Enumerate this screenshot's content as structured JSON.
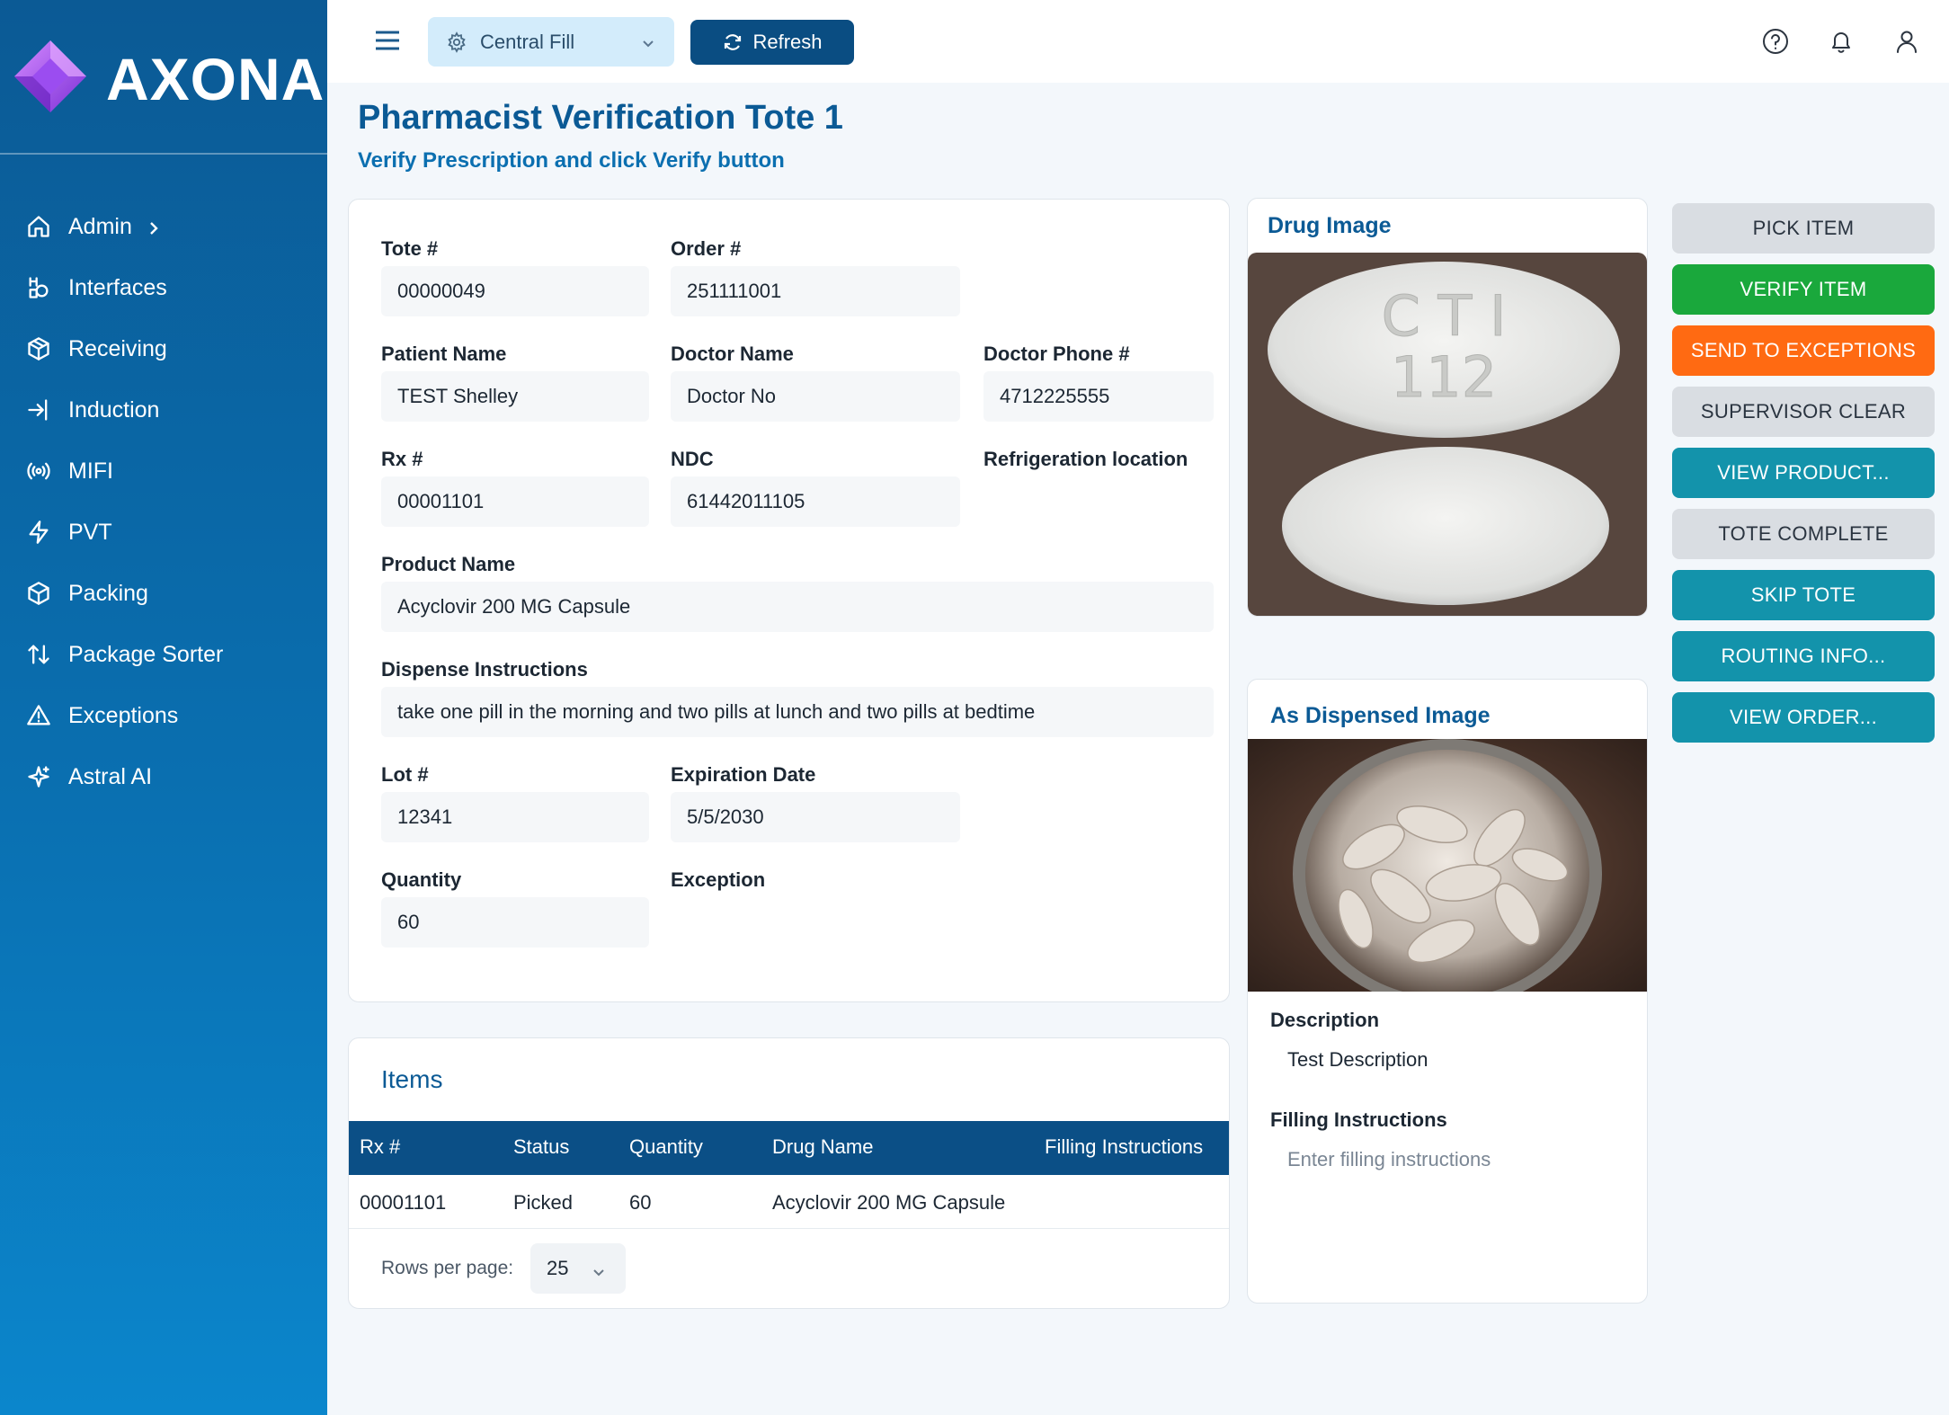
{
  "brand": {
    "name": "AXONA"
  },
  "sidebar": {
    "items": [
      {
        "label": "Admin",
        "icon": "home-icon"
      },
      {
        "label": "Interfaces",
        "icon": "interfaces-icon"
      },
      {
        "label": "Receiving",
        "icon": "package-icon"
      },
      {
        "label": "Induction",
        "icon": "sign-in-icon"
      },
      {
        "label": "MIFI",
        "icon": "broadcast-icon"
      },
      {
        "label": "PVT",
        "icon": "bolt-icon"
      },
      {
        "label": "Packing",
        "icon": "box-icon"
      },
      {
        "label": "Package Sorter",
        "icon": "sort-arrows-icon"
      },
      {
        "label": "Exceptions",
        "icon": "warning-icon"
      },
      {
        "label": "Astral AI",
        "icon": "sparkle-icon"
      }
    ]
  },
  "topbar": {
    "location_select": "Central Fill",
    "refresh_label": "Refresh"
  },
  "header": {
    "title": "Pharmacist Verification Tote 1",
    "subtitle": "Verify Prescription and click Verify button"
  },
  "details": {
    "tote_label": "Tote #",
    "tote_value": "00000049",
    "order_label": "Order #",
    "order_value": "251111001",
    "patient_label": "Patient Name",
    "patient_value": "TEST Shelley",
    "doctor_label": "Doctor Name",
    "doctor_value": "Doctor No",
    "doctor_phone_label": "Doctor Phone #",
    "doctor_phone_value": "4712225555",
    "rx_label": "Rx #",
    "rx_value": "00001101",
    "ndc_label": "NDC",
    "ndc_value": "61442011105",
    "refrig_label": "Refrigeration location",
    "product_label": "Product Name",
    "product_value": "Acyclovir 200 MG Capsule",
    "dispense_label": "Dispense Instructions",
    "dispense_value": "take one pill in the morning and two pills at lunch and two pills at bedtime",
    "lot_label": "Lot #",
    "lot_value": "12341",
    "exp_label": "Expiration Date",
    "exp_value": "5/5/2030",
    "qty_label": "Quantity",
    "qty_value": "60",
    "exception_label": "Exception"
  },
  "items": {
    "title": "Items",
    "columns": [
      "Rx #",
      "Status",
      "Quantity",
      "Drug Name",
      "Filling Instructions"
    ],
    "rows": [
      {
        "rx": "00001101",
        "status": "Picked",
        "quantity": "60",
        "drug": "Acyclovir 200 MG Capsule",
        "filling": ""
      }
    ],
    "rows_per_page_label": "Rows per page:",
    "rows_per_page_value": "25"
  },
  "drug_image": {
    "title": "Drug Image",
    "imprint_line1": "C T I",
    "imprint_line2": "112"
  },
  "dispensed": {
    "title": "As Dispensed Image",
    "description_label": "Description",
    "description_value": "Test Description",
    "filling_label": "Filling Instructions",
    "filling_placeholder": "Enter filling instructions"
  },
  "actions": [
    {
      "label": "PICK ITEM",
      "style": "grey"
    },
    {
      "label": "VERIFY ITEM",
      "style": "green"
    },
    {
      "label": "SEND TO EXCEPTIONS",
      "style": "orange"
    },
    {
      "label": "SUPERVISOR CLEAR",
      "style": "grey"
    },
    {
      "label": "VIEW PRODUCT...",
      "style": "teal"
    },
    {
      "label": "TOTE COMPLETE",
      "style": "grey"
    },
    {
      "label": "SKIP TOTE",
      "style": "teal"
    },
    {
      "label": "ROUTING INFO...",
      "style": "teal"
    },
    {
      "label": "VIEW ORDER...",
      "style": "teal"
    }
  ],
  "colors": {
    "primary": "#0b5a95",
    "verify": "#1aa83c",
    "exceptions": "#ff6a12",
    "teal": "#1393ab",
    "grey": "#d9dde2"
  }
}
